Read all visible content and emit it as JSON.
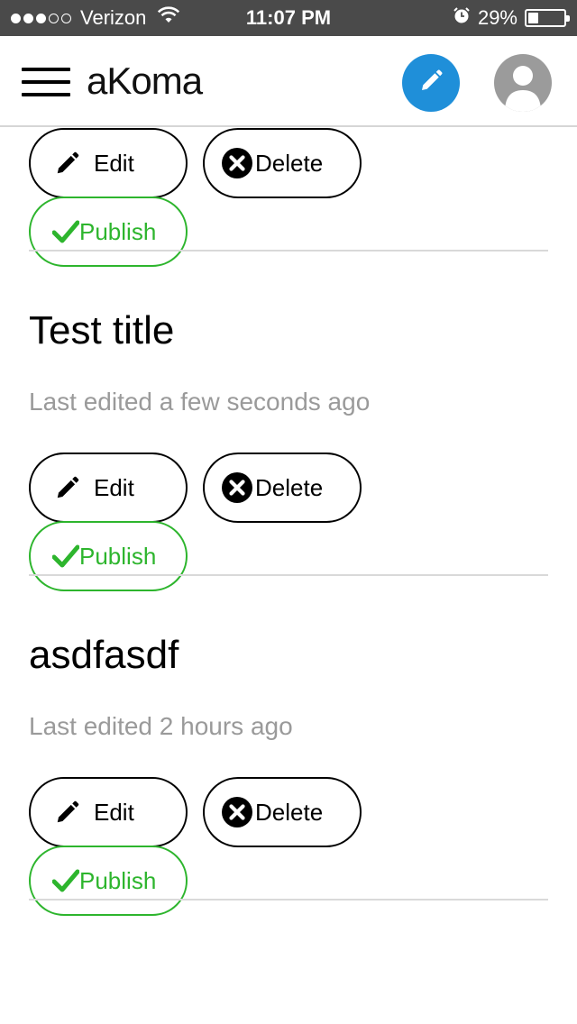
{
  "status_bar": {
    "carrier": "Verizon",
    "time": "11:07 PM",
    "battery_percent": "29%",
    "battery_level": 0.29,
    "signal_bars_filled": 3,
    "signal_bars_total": 5
  },
  "header": {
    "logo": "aKoma",
    "compose_icon": "pencil-icon",
    "menu_icon": "hamburger-menu-icon",
    "avatar_icon": "user-avatar-icon",
    "accent_color": "#1f8fd9"
  },
  "actions": {
    "edit_label": "Edit",
    "delete_label": "Delete",
    "publish_label": "Publish",
    "publish_color": "#2db52d"
  },
  "posts": [
    {
      "title": "",
      "meta": ""
    },
    {
      "title": "Test title",
      "meta": "Last edited a few seconds ago"
    },
    {
      "title": "asdfasdf",
      "meta": "Last edited 2 hours ago"
    }
  ]
}
